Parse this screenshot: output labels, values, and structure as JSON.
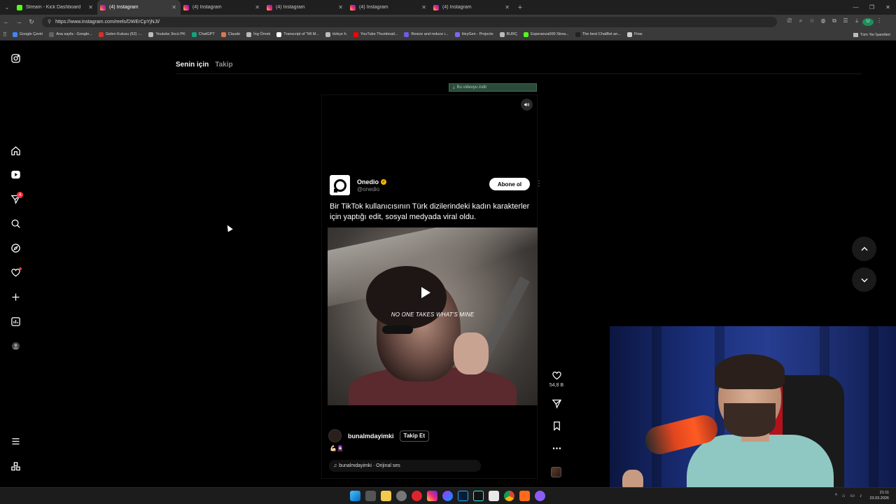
{
  "browser": {
    "tabs": [
      {
        "title": "Stream - Kick Dashboard",
        "favicon": "kick",
        "active": false
      },
      {
        "title": "(4) Instagram",
        "favicon": "ig",
        "active": true
      },
      {
        "title": "(4) Instagram",
        "favicon": "ig",
        "active": false
      },
      {
        "title": "(4) Instagram",
        "favicon": "ig",
        "active": false
      },
      {
        "title": "(4) Instagram",
        "favicon": "ig",
        "active": false
      },
      {
        "title": "(4) Instagram",
        "favicon": "ig",
        "active": false
      }
    ],
    "url": "https://www.instagram.com/reels/DWErCpYjNJI/",
    "bookmarks": [
      "Google Çeviri",
      "Ana sayfa - Google...",
      "Gelen Kutusu (52) -...",
      "Youtube 3ncü PK",
      "ChatGPT",
      "Claude",
      "İng Örnek",
      "Transcript of \"MI M...",
      "türkçe h.",
      "YouTube Thumbnail...",
      "Resize and reduce i...",
      "HeyGen - Projects",
      "BURÇ",
      "Esperanza000 Strea...",
      "The best ChatBot an...",
      "Flow"
    ],
    "bookmarks_right": "Tüm Yer İşaretleri",
    "profile_initial": "U"
  },
  "instagram": {
    "feed_tabs": {
      "for_you": "Senin için",
      "following": "Takip"
    },
    "notification_count": "4",
    "download_bar": "Bu videoyu indir",
    "reel": {
      "source_name": "Onedio",
      "source_handle": "@onedio",
      "subscribe_label": "Abone ol",
      "headline": "Bir TikTok kullanıcısının Türk dizilerindeki kadın karakterler için yaptığı edit, sosyal medyada viral oldu.",
      "video_caption": "NO ONE TAKES WHAT'S MINE",
      "author": "bunalmdayimki",
      "follow_label": "Takip Et",
      "emojis": "💪🏻🧕🏻",
      "audio": "bunalmdayimki · Orijinal ses",
      "like_count": "54,8 B"
    }
  },
  "taskbar": {
    "time": "21:11",
    "date": "23.03.2026"
  }
}
